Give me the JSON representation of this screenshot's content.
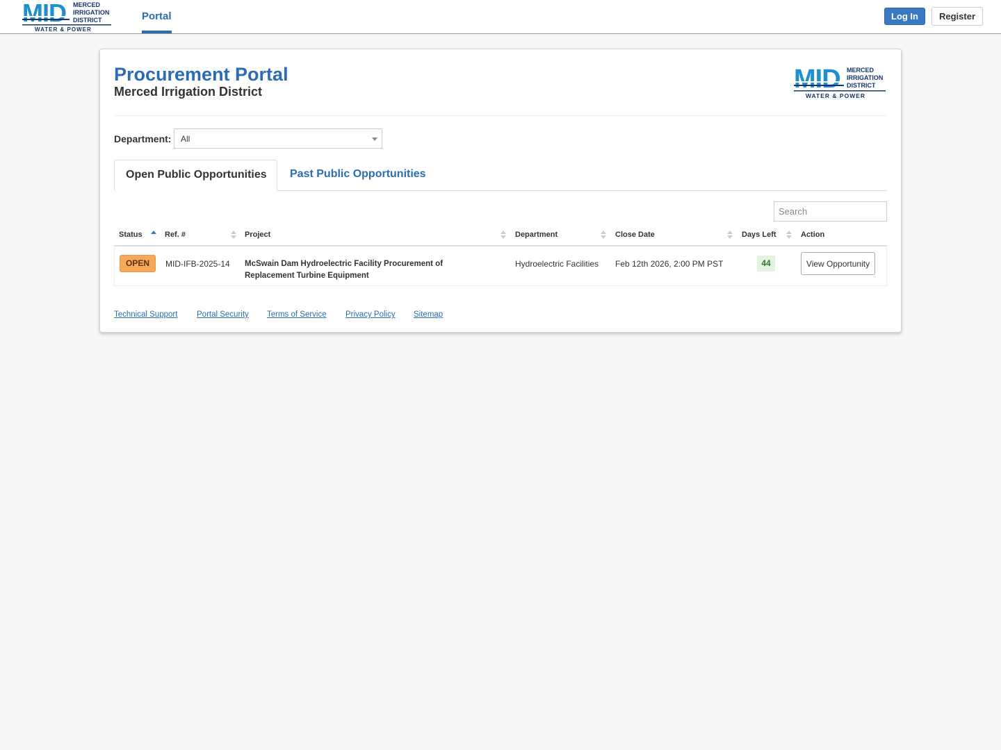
{
  "logo": {
    "letters": "MID",
    "line1": "MERCED",
    "line2": "IRRIGATION",
    "line3": "DISTRICT",
    "tagline": "WATER & POWER"
  },
  "nav": {
    "portal_tab": "Portal",
    "login_label": "Log In",
    "register_label": "Register"
  },
  "header": {
    "title": "Procurement Portal",
    "subtitle": "Merced Irrigation District"
  },
  "filter": {
    "department_label": "Department:",
    "department_value": "All"
  },
  "tabs": [
    {
      "label": "Open Public Opportunities",
      "active": true
    },
    {
      "label": "Past Public Opportunities",
      "active": false
    }
  ],
  "search": {
    "placeholder": "Search",
    "value": ""
  },
  "table": {
    "columns": [
      "Status",
      "Ref. #",
      "Project",
      "Department",
      "Close Date",
      "Days Left",
      "Action"
    ],
    "sort_column": "Status",
    "sort_direction": "ascending",
    "rows": [
      {
        "status": "OPEN",
        "ref": "MID-IFB-2025-14",
        "project": "McSwain Dam Hydroelectric Facility Procurement of Replacement Turbine Equipment",
        "department": "Hydroelectric Facilities",
        "close_date": "Feb 12th 2026, 2:00 PM PST",
        "days_left": "44",
        "action": "View Opportunity"
      }
    ]
  },
  "footer": {
    "links": [
      "Technical Support",
      "Portal Security",
      "Terms of Service",
      "Privacy Policy",
      "Sitemap"
    ]
  },
  "colors": {
    "brand_blue": "#2a6db3",
    "logo_blue": "#1f8fd0",
    "logo_navy": "#15356b",
    "open_badge": "#f6a95a",
    "days_left_bg": "#e4f2e2"
  }
}
